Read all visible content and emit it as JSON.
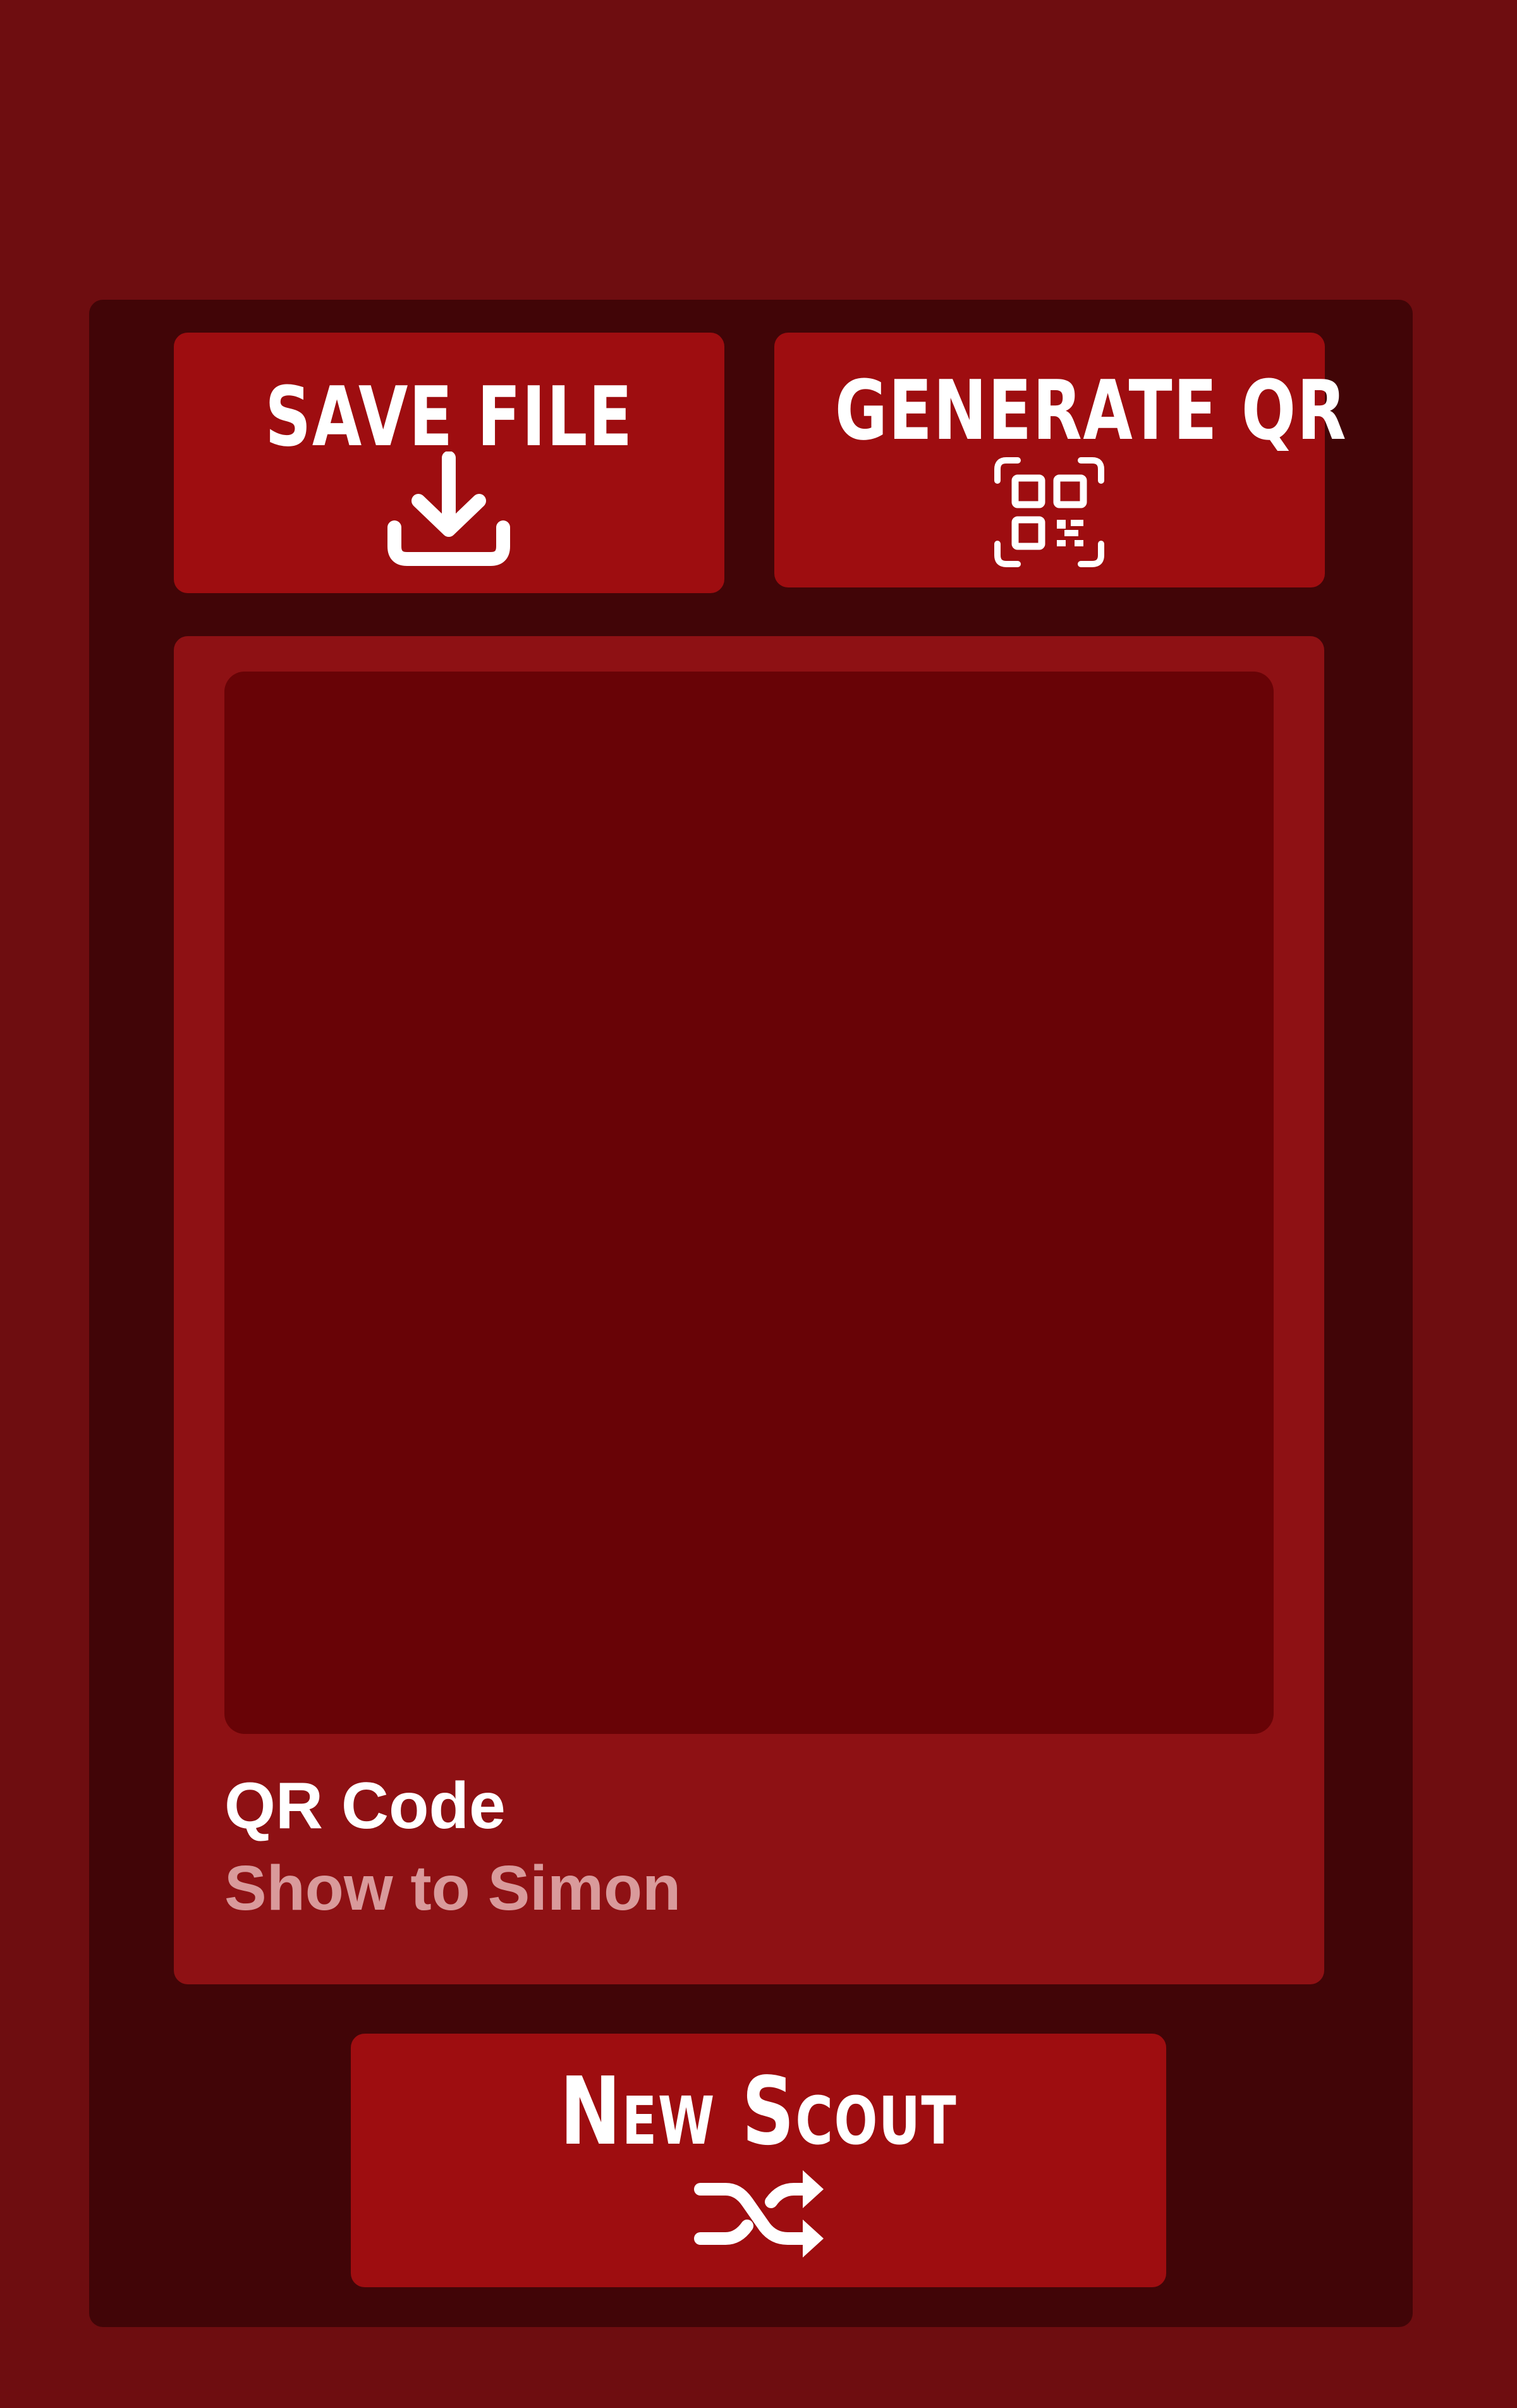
{
  "theme": {
    "background": "#6e0d10",
    "panel": "#410507",
    "button": "#9e0d10",
    "card": "#8e1114",
    "qr_area": "#680306",
    "text": "#ffffff",
    "muted_text": "#d99a9b"
  },
  "actions": {
    "save_file": {
      "label": "SAVE FILE",
      "icon": "download-icon"
    },
    "generate_qr": {
      "label": "GENERATE QR",
      "icon": "qr-scan-icon"
    },
    "new_scout": {
      "label": "New Scout",
      "icon": "shuffle-icon"
    }
  },
  "qr_card": {
    "title": "QR Code",
    "subtitle": "Show to Simon"
  }
}
